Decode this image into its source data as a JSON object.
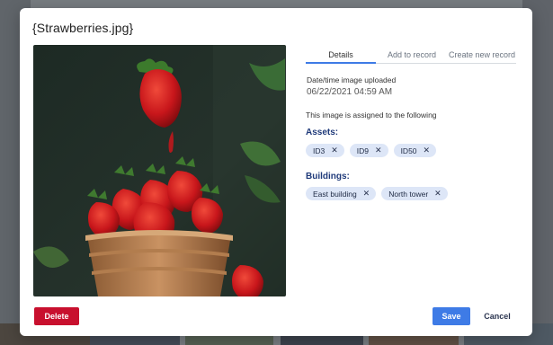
{
  "modal": {
    "title": "{Strawberries.jpg}"
  },
  "tabs": [
    {
      "label": "Details",
      "active": true
    },
    {
      "label": "Add to record",
      "active": false
    },
    {
      "label": "Create new record",
      "active": false
    }
  ],
  "details": {
    "upload_label": "Date/time image uploaded",
    "upload_value": "06/22/2021 04:59 AM",
    "assigned_text": "This image is assigned to the following"
  },
  "assets": {
    "heading": "Assets:",
    "items": [
      "ID3",
      "ID9",
      "ID50"
    ]
  },
  "buildings": {
    "heading": "Buildings:",
    "items": [
      "East building",
      "North tower"
    ]
  },
  "actions": {
    "delete_label": "Delete",
    "save_label": "Save",
    "cancel_label": "Cancel"
  },
  "icons": {
    "chip_remove": "close-icon"
  },
  "colors": {
    "primary": "#3e7be6",
    "danger": "#c8102e",
    "heading": "#1f3a7a",
    "chip_bg": "#dde6f7"
  }
}
